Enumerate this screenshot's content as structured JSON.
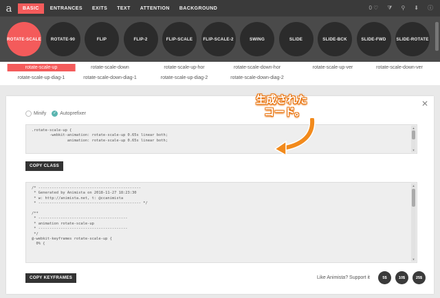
{
  "header": {
    "logo": "a",
    "nav": [
      "BASIC",
      "ENTRANCES",
      "EXITS",
      "TEXT",
      "ATTENTION",
      "BACKGROUND"
    ],
    "active_nav": 0,
    "icons": [
      {
        "name": "favorites-icon",
        "glyph": "0 ♡"
      },
      {
        "name": "filter-icon",
        "glyph": "⧩"
      },
      {
        "name": "pin-icon",
        "glyph": "⚲"
      },
      {
        "name": "download-icon",
        "glyph": "⬇"
      },
      {
        "name": "info-icon",
        "glyph": "ⓘ"
      }
    ]
  },
  "animations": [
    "ROTATE-SCALE",
    "ROTATE-90",
    "FLIP",
    "FLIP-2",
    "FLIP-SCALE",
    "FLIP-SCALE-2",
    "SWING",
    "SLIDE",
    "SLIDE-BCK",
    "SLIDE-FWD",
    "SLIDE-ROTATE"
  ],
  "active_animation": 0,
  "variants": {
    "row1": [
      "rotate-scale-up",
      "rotate-scale-down",
      "rotate-scale-up-hor",
      "rotate-scale-down-hor",
      "rotate-scale-up-ver",
      "rotate-scale-down-ver"
    ],
    "row2": [
      "rotate-scale-up-diag-1",
      "rotate-scale-down-diag-1",
      "rotate-scale-up-diag-2",
      "rotate-scale-down-diag-2"
    ],
    "active": "rotate-scale-up"
  },
  "panel": {
    "close": "✕",
    "options": {
      "minify": "Minify",
      "autoprefixer": "Autoprefixer",
      "check": "✓"
    },
    "class_code": ".rotate-scale-up {\n        -webkit-animation: rotate-scale-up 0.65s linear both;\n                animation: rotate-scale-up 0.65s linear both;",
    "copy_class": "COPY CLASS",
    "keyframes_code": "/* ----------------------------------------------\n * Generated by Animista on 2018-11-27 18:23:30\n * w: http://animista.net, t: @ccanimista\n * ---------------------------------------------- */\n\n/**\n * ----------------------------------------\n * animation rotate-scale-up\n * ----------------------------------------\n */\n@-webkit-keyframes rotate-scale-up {\n  0% {",
    "copy_keyframes": "COPY KEYFRAMES",
    "support_label": "Like Animista? Support it",
    "donations": [
      "5$",
      "10$",
      "25$"
    ],
    "scroll_up": "▲",
    "scroll_down": "▼"
  },
  "annotation": {
    "line1": "生成された",
    "line2": "コード。",
    "color": "#f28a1c"
  },
  "colors": {
    "accent": "#f45b5b",
    "topbar": "#3a3a3a",
    "strip": "#4a4a4a",
    "circle": "#2b2b2b"
  }
}
